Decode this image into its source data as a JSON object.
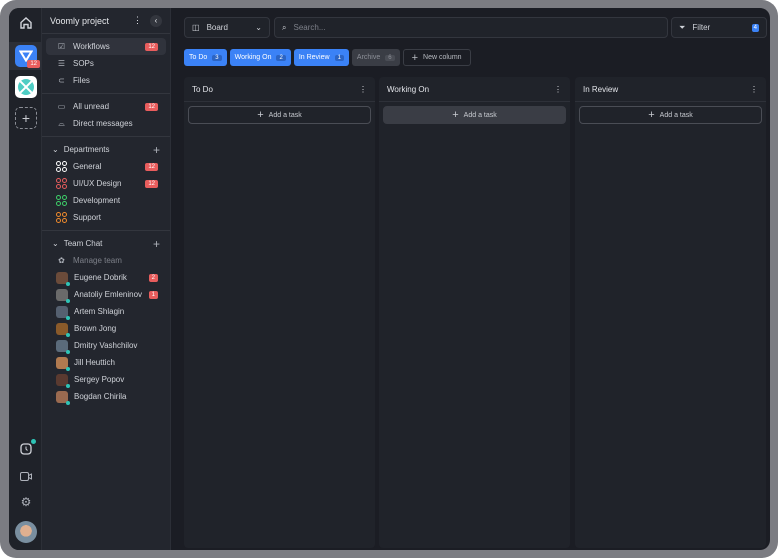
{
  "project": {
    "title": "Voomly project"
  },
  "rail": {
    "app_badge": "12"
  },
  "nav": [
    {
      "label": "Workflows",
      "badge": "12",
      "icon": "clipboard-check-icon"
    },
    {
      "label": "SOPs",
      "icon": "list-icon"
    },
    {
      "label": "Files",
      "icon": "paperclip-icon"
    }
  ],
  "inbox": [
    {
      "label": "All unread",
      "badge": "12"
    },
    {
      "label": "Direct messages"
    }
  ],
  "departments": {
    "title": "Departments",
    "items": [
      {
        "label": "General",
        "badge": "12",
        "color": "#ffffff"
      },
      {
        "label": "UI/UX Design",
        "badge": "12",
        "color": "#e85d5d"
      },
      {
        "label": "Development",
        "badge": "",
        "color": "#3ecf6a"
      },
      {
        "label": "Support",
        "badge": "",
        "color": "#f08a2c"
      }
    ]
  },
  "team": {
    "title": "Team Chat",
    "manage": "Manage team",
    "members": [
      {
        "name": "Eugene Dobrik",
        "badge": "2",
        "color": "#6b4b3a"
      },
      {
        "name": "Anatoliy Emleninov",
        "badge": "1",
        "color": "#6a6a6a"
      },
      {
        "name": "Artem Shlagin",
        "badge": "",
        "color": "#556070"
      },
      {
        "name": "Brown Jong",
        "badge": "",
        "color": "#8a5a2a"
      },
      {
        "name": "Dmitry Vashchilov",
        "badge": "",
        "color": "#5b6b7b"
      },
      {
        "name": "Jill Heuttich",
        "badge": "",
        "color": "#b07a50"
      },
      {
        "name": "Sergey Popov",
        "badge": "",
        "color": "#5a3a30"
      },
      {
        "name": "Bogdan Chirila",
        "badge": "",
        "color": "#9a6a50"
      }
    ]
  },
  "toolbar": {
    "view": "Board",
    "search_placeholder": "Search...",
    "filter": "Filter",
    "filter_count": "4"
  },
  "tabs": [
    {
      "label": "To Do",
      "count": "3"
    },
    {
      "label": "Working On",
      "count": "2"
    },
    {
      "label": "In Review",
      "count": "1"
    },
    {
      "label": "Archive",
      "count": "6"
    }
  ],
  "new_column": "New column",
  "columns": [
    {
      "title": "To Do",
      "add": "Add a task"
    },
    {
      "title": "Working On",
      "add": "Add a task"
    },
    {
      "title": "In Review",
      "add": "Add a task"
    }
  ],
  "colors": {
    "accent": "#3b82f6",
    "badge": "#e85d5d"
  }
}
